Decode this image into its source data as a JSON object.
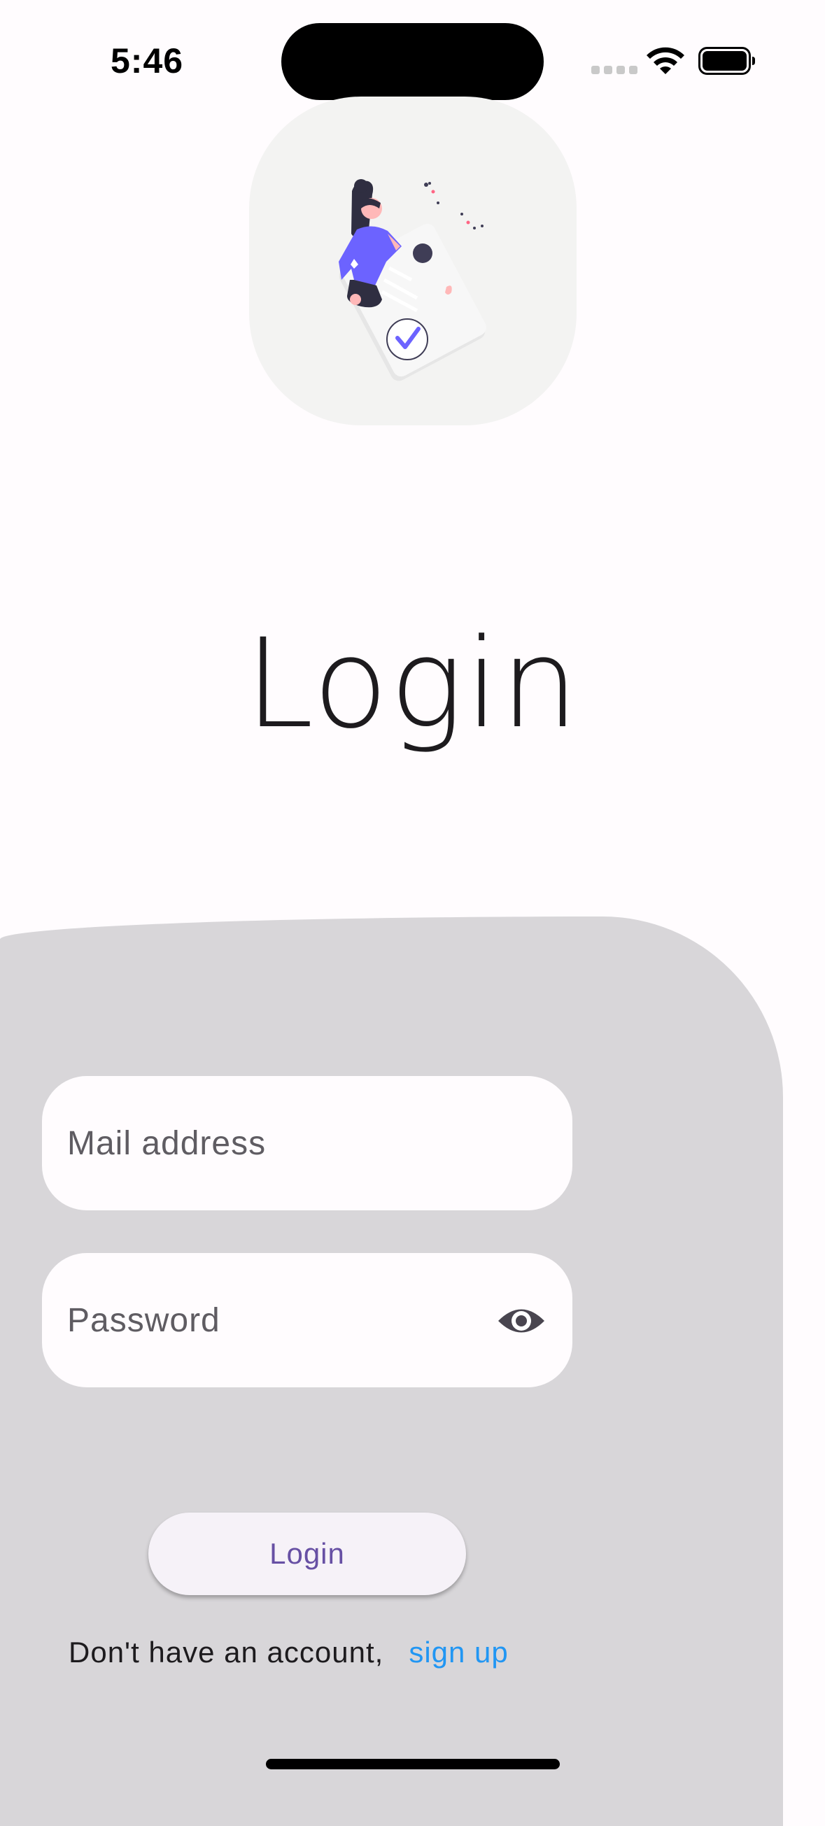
{
  "status_bar": {
    "time": "5:46",
    "wifi_icon": "wifi-icon",
    "battery_icon": "battery-icon"
  },
  "logo": {
    "icon": "person-holding-checked-document-illustration",
    "accent_color": "#6c63ff"
  },
  "header": {
    "title": "Login"
  },
  "form": {
    "email_placeholder": "Mail address",
    "email_value": "",
    "password_placeholder": "Password",
    "password_value": "",
    "password_toggle_icon": "eye-icon",
    "login_label": "Login"
  },
  "footer": {
    "prompt": "Don't have an account,",
    "signup_label": "sign up"
  },
  "colors": {
    "background": "#fffcfe",
    "panel": "#d8d6d9",
    "primary": "#6750a4",
    "link": "#2196f3"
  }
}
